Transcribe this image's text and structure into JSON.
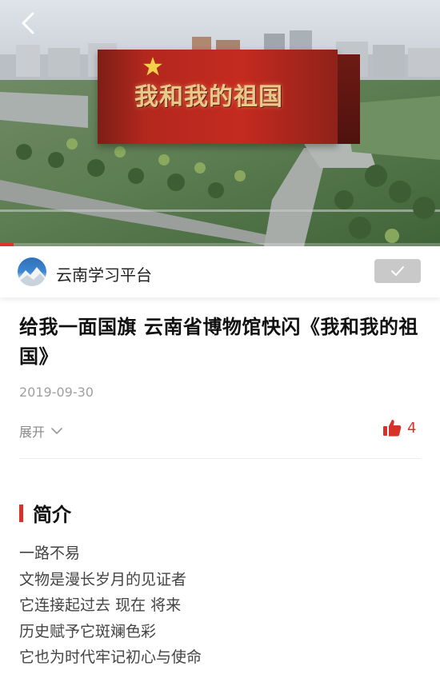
{
  "video": {
    "caption": "我和我的祖国",
    "progress": 0.03,
    "accent": "#e0312a",
    "back_icon": "chevron-left-icon"
  },
  "channel": {
    "name": "云南学习平台",
    "follow_icon": "checkmark-icon",
    "follow_bg": "#c9c9c9"
  },
  "article": {
    "title": "给我一面国旗  云南省博物馆快闪《我和我的祖国》",
    "date": "2019-09-30",
    "expand_label": "展开",
    "expand_icon": "chevron-down-icon",
    "like_icon": "thumbs-up-icon",
    "like_count": "4",
    "like_color": "#d7322a"
  },
  "intro": {
    "heading": "简介",
    "lines": [
      "一路不易",
      "文物是漫长岁月的见证者",
      "它连接起过去  现在  将来",
      "历史赋予它斑斓色彩",
      "它也为时代牢记初心与使命"
    ]
  }
}
